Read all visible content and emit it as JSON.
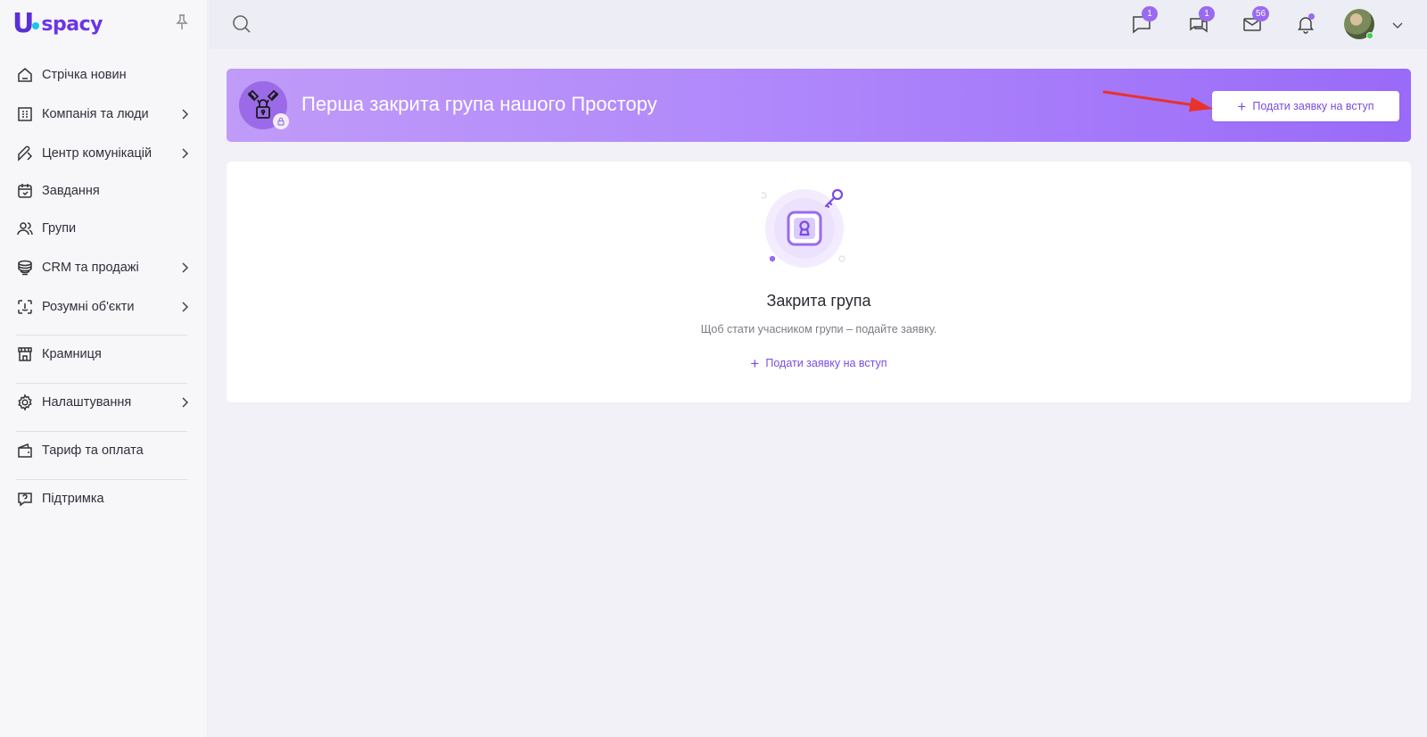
{
  "brand": {
    "logo_text": "spacy"
  },
  "sidebar": {
    "items": [
      {
        "label": "Стрічка новин",
        "has_submenu": false
      },
      {
        "label": "Компанія та люди",
        "has_submenu": true
      },
      {
        "label": "Центр комунікацій",
        "has_submenu": true
      },
      {
        "label": "Завдання",
        "has_submenu": false
      },
      {
        "label": "Групи",
        "has_submenu": false
      },
      {
        "label": "CRM та продажі",
        "has_submenu": true
      },
      {
        "label": "Розумні об'єкти",
        "has_submenu": true
      },
      {
        "label": "Крамниця",
        "has_submenu": false
      },
      {
        "label": "Налаштування",
        "has_submenu": true
      },
      {
        "label": "Тариф та оплата",
        "has_submenu": false
      },
      {
        "label": "Підтримка",
        "has_submenu": false
      }
    ]
  },
  "header": {
    "chat_badge": "1",
    "comments_badge": "1",
    "mail_badge": "56",
    "notifications_dot": true
  },
  "banner": {
    "title": "Перша закрита група нашого Простору",
    "join_button": "Подати заявку на вступ"
  },
  "card": {
    "title": "Закрита група",
    "subtitle": "Щоб стати учасником групи – подайте заявку.",
    "join_button": "Подати заявку на вступ"
  },
  "colors": {
    "accent": "#7a4ce0",
    "badge": "#9a6af0",
    "arrow": "#e8322a"
  }
}
